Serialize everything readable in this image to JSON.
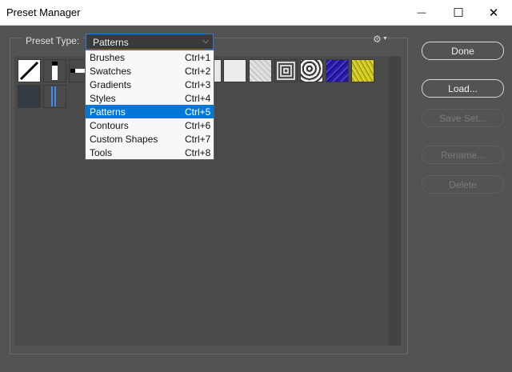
{
  "window": {
    "title": "Preset Manager",
    "minimize_glyph": "—",
    "maximize_glyph": "☐",
    "close_glyph": "✕"
  },
  "preset_type": {
    "label": "Preset Type:",
    "value": "Patterns",
    "chevron_glyph": "⌵"
  },
  "gear_icon": {
    "glyph": "⚙",
    "caret": "▼"
  },
  "menu": {
    "items": [
      {
        "label": "Brushes",
        "shortcut": "Ctrl+1"
      },
      {
        "label": "Swatches",
        "shortcut": "Ctrl+2"
      },
      {
        "label": "Gradients",
        "shortcut": "Ctrl+3"
      },
      {
        "label": "Styles",
        "shortcut": "Ctrl+4"
      },
      {
        "label": "Patterns",
        "shortcut": "Ctrl+5"
      },
      {
        "label": "Contours",
        "shortcut": "Ctrl+6"
      },
      {
        "label": "Custom Shapes",
        "shortcut": "Ctrl+7"
      },
      {
        "label": "Tools",
        "shortcut": "Ctrl+8"
      }
    ],
    "selected_index": 4
  },
  "buttons": {
    "done": "Done",
    "load": "Load...",
    "save_set": "Save Set...",
    "rename": "Rename...",
    "delete": "Delete"
  },
  "colors": {
    "dialog_bg": "#535353",
    "panel_bg": "#4a4a4a",
    "menu_highlight": "#0078d7",
    "dropdown_border": "#2f7ad6"
  }
}
